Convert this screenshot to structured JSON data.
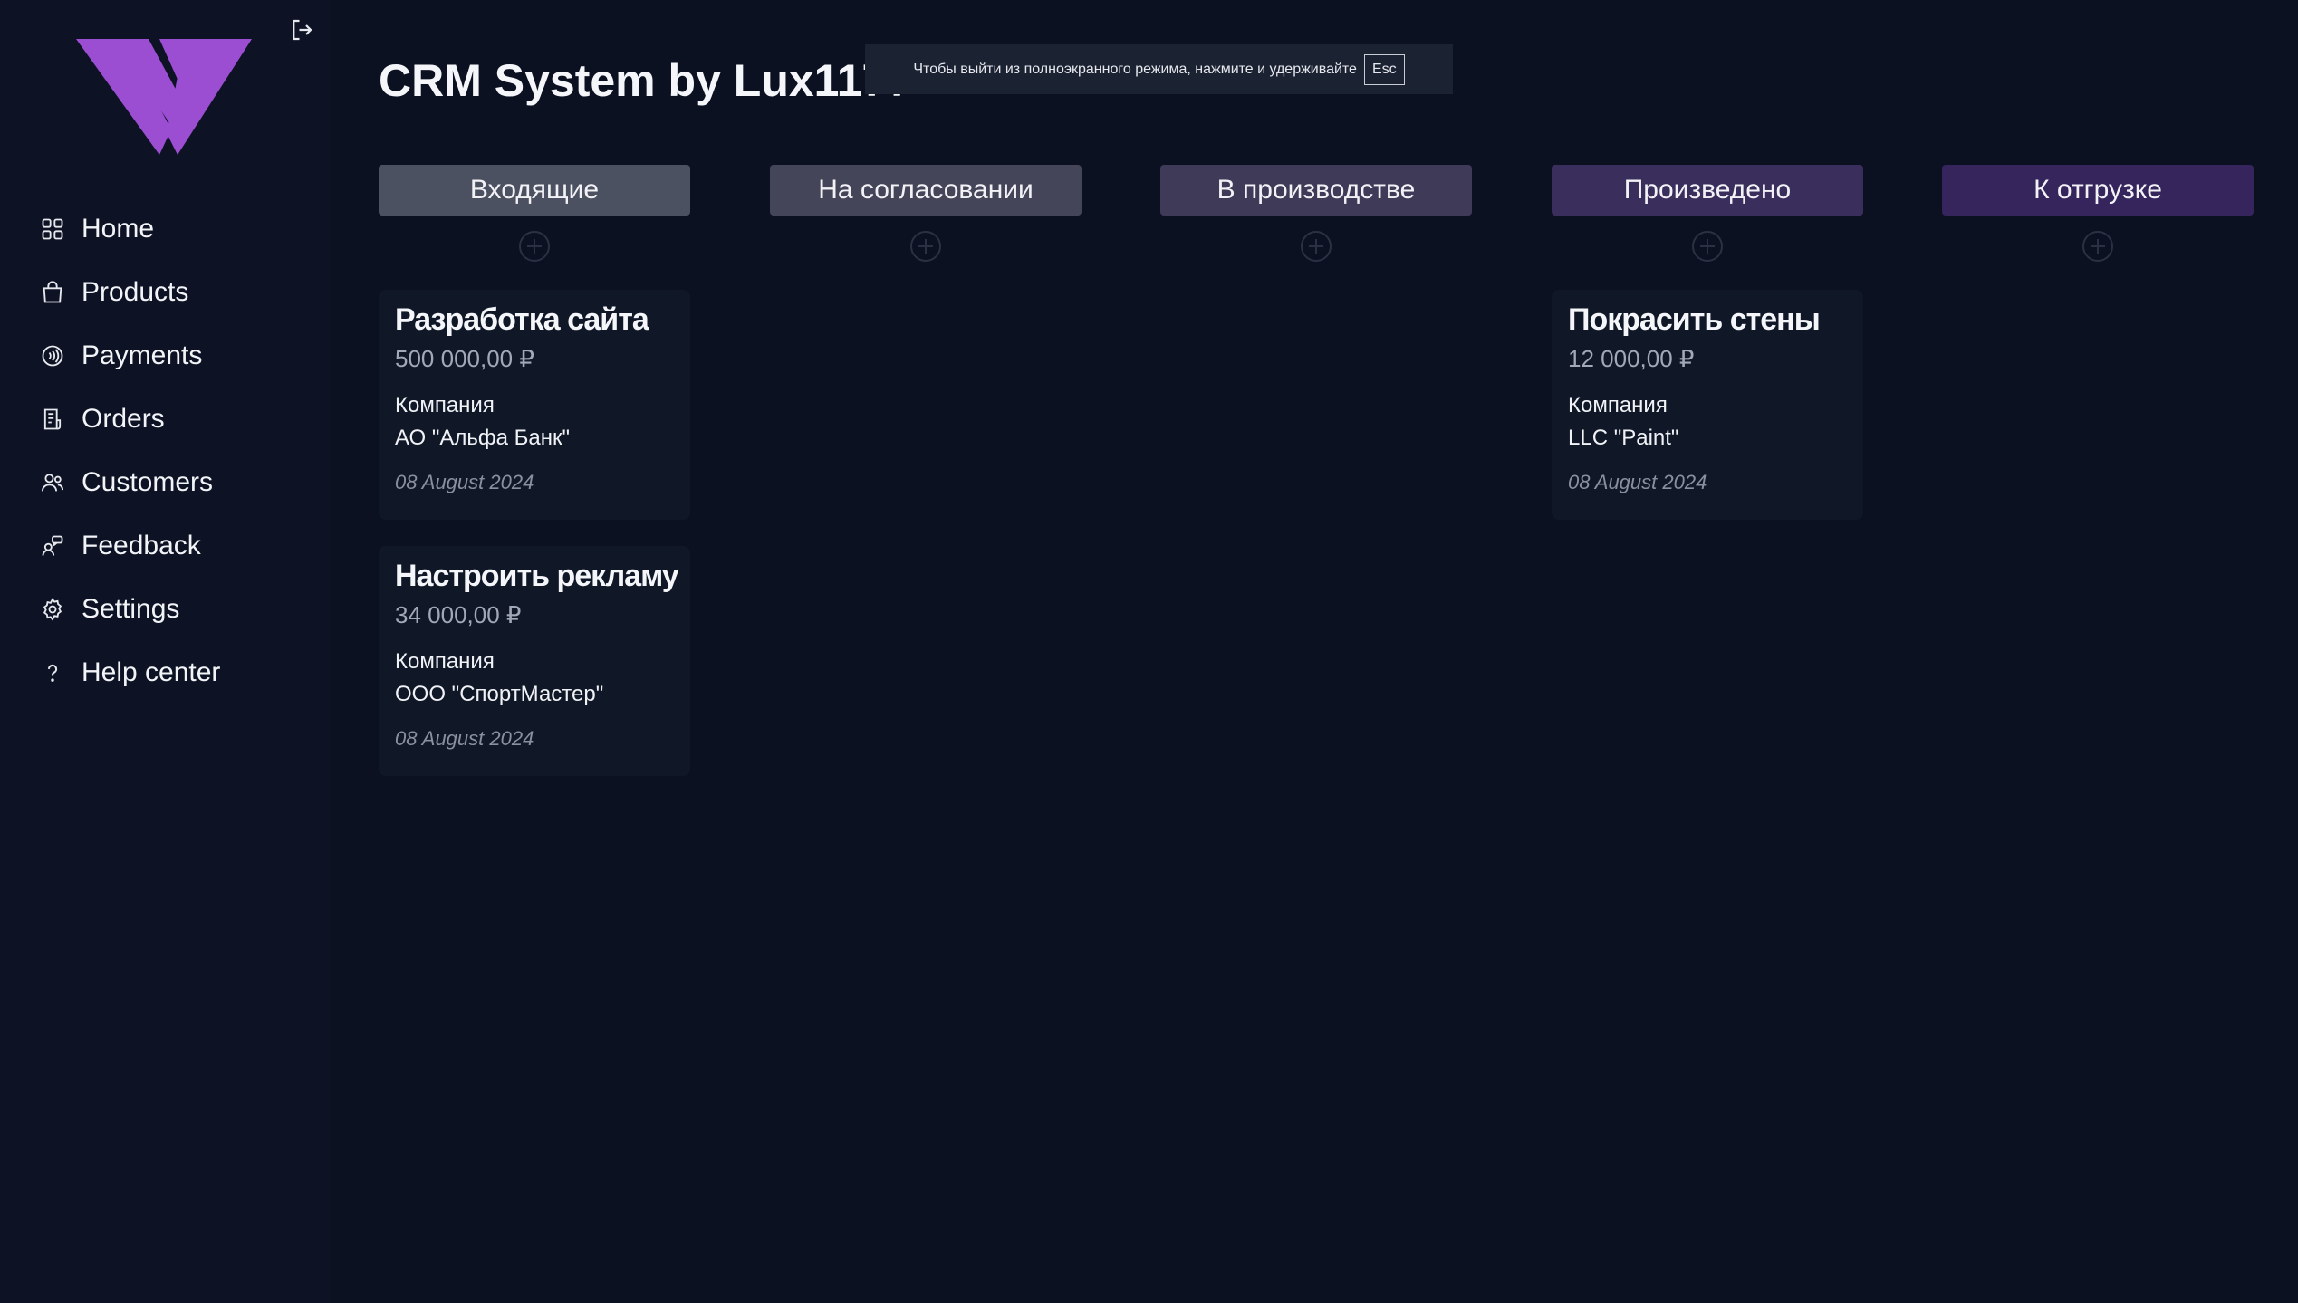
{
  "app": {
    "title": "CRM System by Lux1177"
  },
  "toast": {
    "text": "Чтобы выйти из полноэкранного режима, нажмите и удерживайте",
    "key": "Esc"
  },
  "colors": {
    "accent": "#9b4ed1",
    "background": "#0b1121",
    "card": "#101828"
  },
  "sidebar": {
    "items": [
      {
        "label": "Home",
        "icon": "grid-icon"
      },
      {
        "label": "Products",
        "icon": "bag-icon"
      },
      {
        "label": "Payments",
        "icon": "contactless-icon"
      },
      {
        "label": "Orders",
        "icon": "receipt-icon"
      },
      {
        "label": "Customers",
        "icon": "users-icon"
      },
      {
        "label": "Feedback",
        "icon": "feedback-icon"
      },
      {
        "label": "Settings",
        "icon": "gear-icon"
      },
      {
        "label": "Help center",
        "icon": "question-icon"
      }
    ]
  },
  "columns": [
    {
      "label": "Входящие",
      "color": "#4b5160"
    },
    {
      "label": "На согласовании",
      "color": "#444559"
    },
    {
      "label": "В производстве",
      "color": "#3f3a58"
    },
    {
      "label": "Произведено",
      "color": "#3a2f5c"
    },
    {
      "label": "К отгрузке",
      "color": "#36255c"
    }
  ],
  "cards": [
    {
      "title": "Разработка сайта",
      "price": "500 000,00 ₽",
      "company_label": "Компания",
      "company": "АО \"Альфа Банк\"",
      "date": "08 August 2024"
    },
    {
      "title": "Настроить рекламу",
      "price": "34 000,00 ₽",
      "company_label": "Компания",
      "company": "ООО \"СпортМастер\"",
      "date": "08 August 2024"
    },
    {
      "title": "Покрасить стены",
      "price": "12 000,00 ₽",
      "company_label": "Компания",
      "company": "LLC \"Paint\"",
      "date": "08 August 2024"
    }
  ]
}
